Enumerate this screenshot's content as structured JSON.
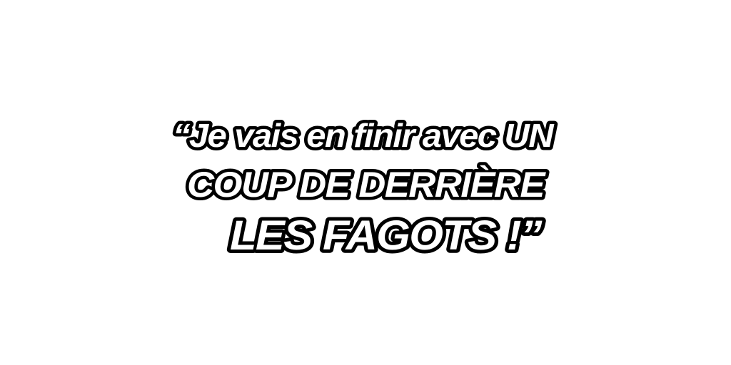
{
  "quote": {
    "line1": "“Je vais en finir avec UN",
    "line2": "COUP DE DERRIÈRE",
    "line3": "LES FAGOTS !”"
  },
  "colors": {
    "background": "#ffffff",
    "text_fill": "#ffffff",
    "text_outline": "#000000"
  }
}
